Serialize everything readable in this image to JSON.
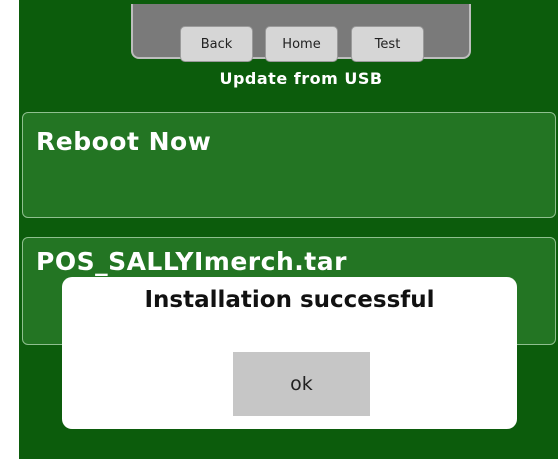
{
  "toolbar": {
    "back_label": "Back",
    "home_label": "Home",
    "test_label": "Test"
  },
  "header": {
    "title": "Update from USB"
  },
  "actions": {
    "reboot_label": "Reboot Now",
    "file_label": "POS_SALLYImerch.tar"
  },
  "dialog": {
    "message": "Installation successful",
    "ok_label": "ok"
  },
  "colors": {
    "background_green": "#0c5c0c",
    "panel_green": "#237523",
    "toolbar_gray": "#7a7a7a",
    "button_gray": "#d6d6d6"
  }
}
